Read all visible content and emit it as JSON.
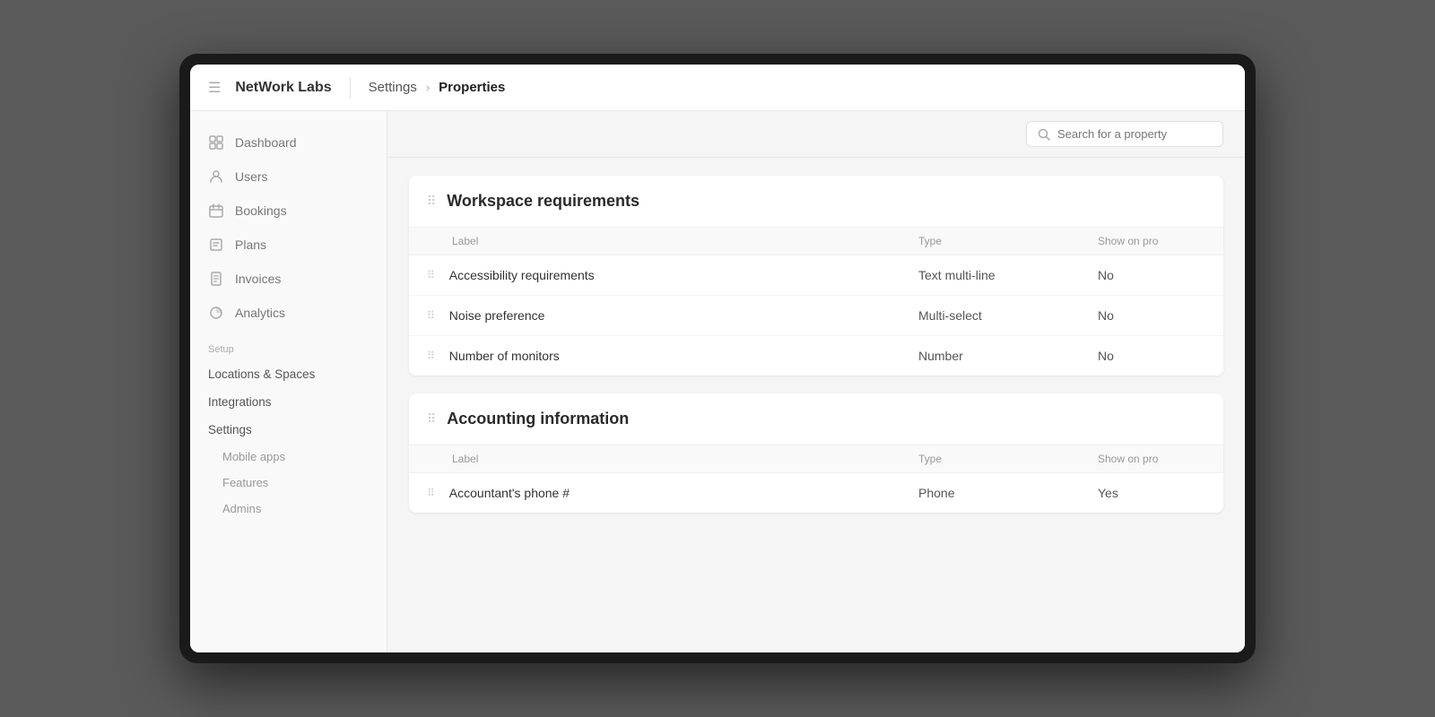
{
  "app": {
    "name": "NetWork Labs",
    "menu_icon": "☰"
  },
  "breadcrumb": {
    "items": [
      {
        "label": "Settings",
        "active": false
      },
      {
        "label": "Properties",
        "active": true
      }
    ]
  },
  "sidebar": {
    "nav_items": [
      {
        "id": "dashboard",
        "label": "Dashboard",
        "icon": "dashboard"
      },
      {
        "id": "users",
        "label": "Users",
        "icon": "users"
      },
      {
        "id": "bookings",
        "label": "Bookings",
        "icon": "bookings"
      },
      {
        "id": "plans",
        "label": "Plans",
        "icon": "plans"
      },
      {
        "id": "invoices",
        "label": "Invoices",
        "icon": "invoices"
      },
      {
        "id": "analytics",
        "label": "Analytics",
        "icon": "analytics"
      }
    ],
    "setup_label": "Setup",
    "setup_links": [
      {
        "id": "locations",
        "label": "Locations & Spaces"
      },
      {
        "id": "integrations",
        "label": "Integrations"
      },
      {
        "id": "settings",
        "label": "Settings"
      }
    ],
    "settings_sub": [
      {
        "id": "mobile-apps",
        "label": "Mobile apps"
      },
      {
        "id": "features",
        "label": "Features"
      },
      {
        "id": "admins",
        "label": "Admins"
      }
    ]
  },
  "search": {
    "placeholder": "Search for a property"
  },
  "groups": [
    {
      "id": "workspace-requirements",
      "title": "Workspace requirements",
      "columns": {
        "label": "Label",
        "type": "Type",
        "show": "Show on pro"
      },
      "rows": [
        {
          "label": "Accessibility requirements",
          "type": "Text multi-line",
          "show": "No"
        },
        {
          "label": "Noise preference",
          "type": "Multi-select",
          "show": "No"
        },
        {
          "label": "Number of monitors",
          "type": "Number",
          "show": "No"
        }
      ]
    },
    {
      "id": "accounting-information",
      "title": "Accounting information",
      "columns": {
        "label": "Label",
        "type": "Type",
        "show": "Show on pro"
      },
      "rows": [
        {
          "label": "Accountant's phone #",
          "type": "Phone",
          "show": "Yes"
        }
      ]
    }
  ]
}
